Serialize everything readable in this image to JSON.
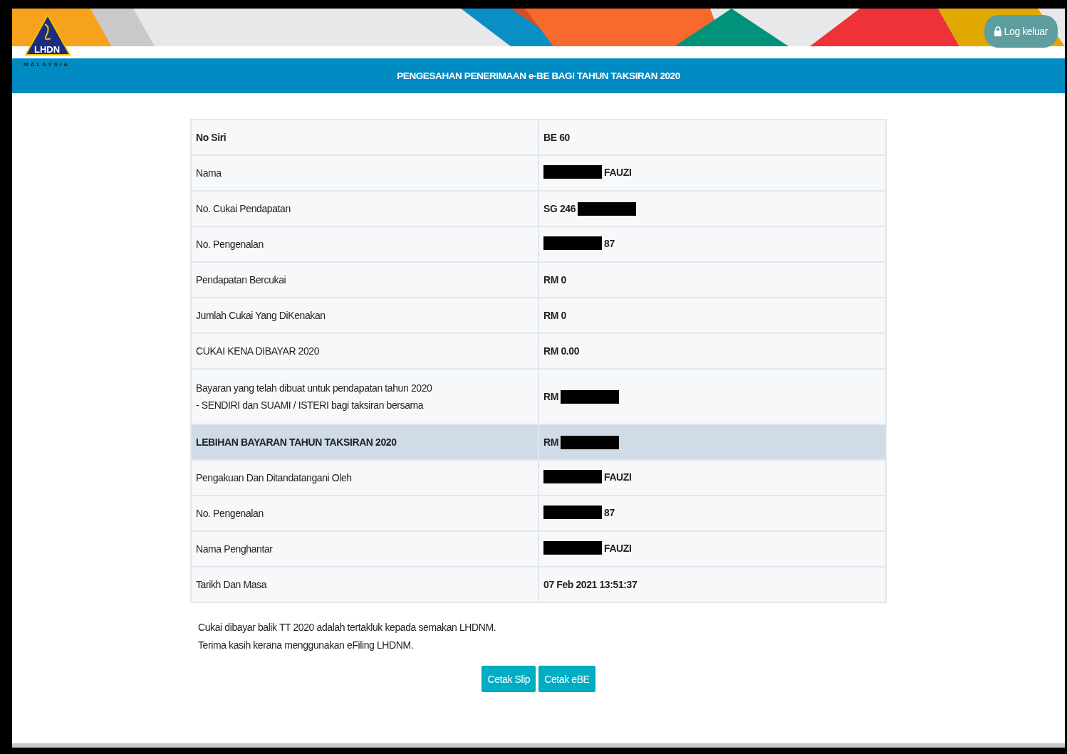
{
  "logo": {
    "wordmark": "LHDN",
    "country": "MALAYSIA"
  },
  "logout_button": {
    "label": "Log keluar"
  },
  "title_bar": {
    "title": "PENGESAHAN PENERIMAAN e-BE BAGI TAHUN TAKSIRAN 2020"
  },
  "summary_table": {
    "rows": [
      {
        "kind": "plain",
        "label": "No Siri",
        "value": "BE 60",
        "strong": true,
        "highlighted": false
      },
      {
        "kind": "masked-before",
        "label": "Nama",
        "value": "FAUZI",
        "strong": false,
        "highlighted": false
      },
      {
        "kind": "masked-after",
        "label": "No. Cukai Pendapatan",
        "value": "SG 246",
        "strong": false,
        "highlighted": false
      },
      {
        "kind": "masked-before",
        "label": "No. Pengenalan",
        "value": "87",
        "strong": false,
        "highlighted": false
      },
      {
        "kind": "plain",
        "label": "Pendapatan Bercukai",
        "value": "RM 0",
        "strong": false,
        "highlighted": false
      },
      {
        "kind": "plain",
        "label": "Jumlah Cukai Yang DiKenakan",
        "value": "RM 0",
        "strong": false,
        "highlighted": false
      },
      {
        "kind": "plain",
        "label": "CUKAI KENA DIBAYAR 2020",
        "value": "RM 0.00",
        "strong": false,
        "highlighted": false
      },
      {
        "kind": "masked-after",
        "label": "Bayaran yang telah dibuat untuk pendapatan tahun 2020",
        "note": "- SENDIRI dan SUAMI / ISTERI bagi taksiran bersama",
        "value": "RM",
        "strong": false,
        "highlighted": false
      },
      {
        "kind": "masked-after",
        "label": "LEBIHAN BAYARAN TAHUN TAKSIRAN 2020",
        "value": "RM",
        "strong": true,
        "highlighted": true
      },
      {
        "kind": "masked-before",
        "label": "Pengakuan Dan Ditandatangani Oleh",
        "value": "FAUZI",
        "strong": false,
        "highlighted": false
      },
      {
        "kind": "masked-before",
        "label": "No. Pengenalan",
        "value": "87",
        "strong": false,
        "highlighted": false
      },
      {
        "kind": "masked-before",
        "label": "Nama Penghantar",
        "value": "FAUZI",
        "strong": false,
        "highlighted": false
      },
      {
        "kind": "plain",
        "label": "Tarikh Dan Masa",
        "value": "07 Feb 2021 13:51:37",
        "strong": false,
        "highlighted": false
      }
    ]
  },
  "notes": [
    "Cukai dibayar balik TT 2020 adalah tertakluk kepada semakan LHDNM.",
    "Terima kasih kerana menggunakan eFiling LHDNM."
  ],
  "buttons": [
    "Cetak Slip",
    "Cetak eBE"
  ]
}
